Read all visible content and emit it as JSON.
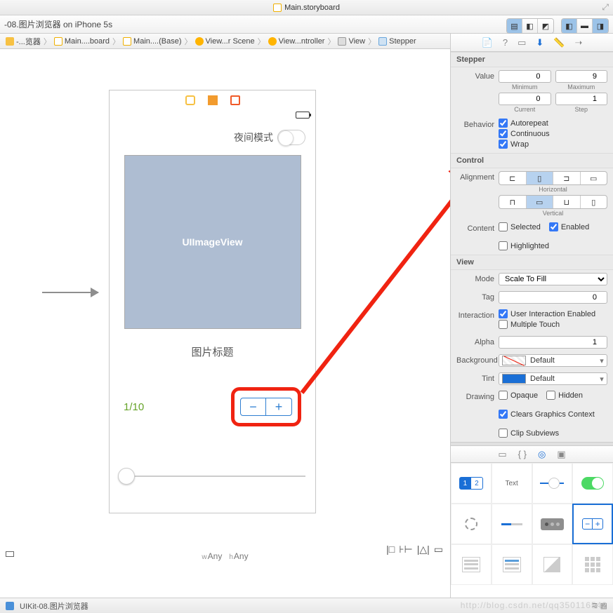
{
  "titlebar": {
    "filename": "Main.storyboard"
  },
  "scheme": "-08.图片浏览器 on iPhone 5s",
  "breadcrumbs": [
    {
      "icon": "folder",
      "label": "-...览器"
    },
    {
      "icon": "story",
      "label": "Main....board"
    },
    {
      "icon": "story",
      "label": "Main....(Base)"
    },
    {
      "icon": "scene",
      "label": "View...r Scene"
    },
    {
      "icon": "vc",
      "label": "View...ntroller"
    },
    {
      "icon": "view",
      "label": "View"
    },
    {
      "icon": "step",
      "label": "Stepper"
    }
  ],
  "canvas": {
    "night_mode": "夜间模式",
    "imgview": "UIImageView",
    "img_title": "图片标题",
    "counter": "1/10",
    "sizeclass_w": "Any",
    "sizeclass_h": "Any"
  },
  "inspector": {
    "stepper": {
      "header": "Stepper",
      "value_label": "Value",
      "min_label": "Minimum",
      "min": "0",
      "max_label": "Maximum",
      "max": "9",
      "cur_label": "Current",
      "cur": "0",
      "step_label": "Step",
      "step": "1",
      "behavior_label": "Behavior",
      "autorepeat": "Autorepeat",
      "continuous": "Continuous",
      "wrap": "Wrap"
    },
    "control": {
      "header": "Control",
      "alignment": "Alignment",
      "horizontal": "Horizontal",
      "vertical": "Vertical",
      "content": "Content",
      "selected": "Selected",
      "enabled": "Enabled",
      "highlighted": "Highlighted"
    },
    "view": {
      "header": "View",
      "mode": "Mode",
      "mode_val": "Scale To Fill",
      "tag": "Tag",
      "tag_val": "0",
      "interaction": "Interaction",
      "uie": "User Interaction Enabled",
      "multi": "Multiple Touch",
      "alpha": "Alpha",
      "alpha_val": "1",
      "background": "Background",
      "bg_val": "Default",
      "tint": "Tint",
      "tint_val": "Default",
      "drawing": "Drawing",
      "opaque": "Opaque",
      "hidden": "Hidden",
      "clears": "Clears Graphics Context",
      "clip": "Clip Subviews"
    },
    "lib": {
      "text": "Text"
    }
  },
  "statusline": {
    "project": "UIKit-08.图片浏览器"
  },
  "watermark": "http://blog.csdn.net/qq350116542"
}
